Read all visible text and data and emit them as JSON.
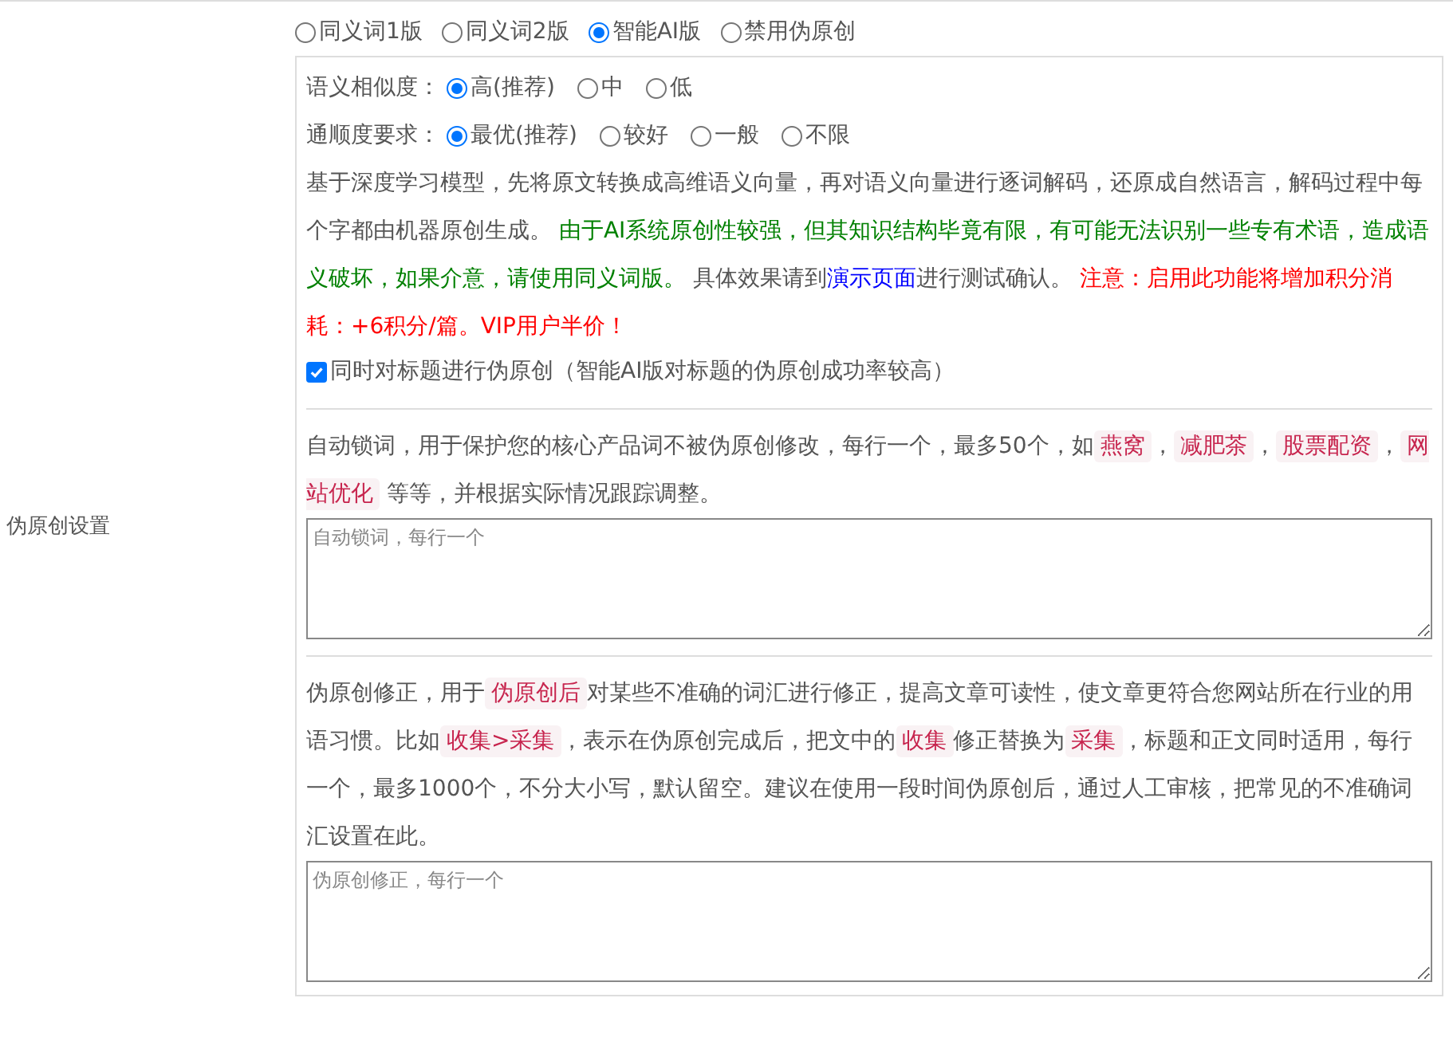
{
  "section_label": "伪原创设置",
  "modes": [
    {
      "label": "同义词1版",
      "selected": false
    },
    {
      "label": "同义词2版",
      "selected": false
    },
    {
      "label": "智能AI版",
      "selected": true
    },
    {
      "label": "禁用伪原创",
      "selected": false
    }
  ],
  "ai_settings": {
    "rows": [
      {
        "label": "语义相似度：",
        "options": [
          {
            "label": "高(推荐)",
            "selected": true
          },
          {
            "label": "中",
            "selected": false
          },
          {
            "label": "低",
            "selected": false
          }
        ]
      },
      {
        "label": "通顺度要求：",
        "options": [
          {
            "label": "最优(推荐)",
            "selected": true
          },
          {
            "label": "较好",
            "selected": false
          },
          {
            "label": "一般",
            "selected": false
          },
          {
            "label": "不限",
            "selected": false
          }
        ]
      }
    ],
    "description": [
      {
        "kind": "text",
        "text": "基于深度学习模型，先将原文转换成高维语义向量，再对语义向量进行逐词解码，还原成自然语言，解码过程中每个字都由机器原创生成。 "
      },
      {
        "kind": "green",
        "text": "由于AI系统原创性较强，但其知识结构毕竟有限，有可能无法识别一些专有术语，造成语义破坏，如果介意，请使用同义词版。"
      },
      {
        "kind": "text",
        "text": " 具体效果请到"
      },
      {
        "kind": "link",
        "text": "演示页面"
      },
      {
        "kind": "text",
        "text": "进行测试确认。 "
      },
      {
        "kind": "red",
        "text": "注意：启用此功能将增加积分消耗：+6积分/篇。VIP用户半价！"
      }
    ],
    "title_rewrite": {
      "label": "同时对标题进行伪原创（智能AI版对标题的伪原创成功率较高）",
      "checked": true
    }
  },
  "lock_words": {
    "description": [
      {
        "kind": "text",
        "text": "自动锁词，用于保护您的核心产品词不被伪原创修改，每行一个，最多50个，如"
      },
      {
        "kind": "tag",
        "text": "燕窝"
      },
      {
        "kind": "text",
        "text": "，"
      },
      {
        "kind": "tag",
        "text": "减肥茶"
      },
      {
        "kind": "text",
        "text": "，"
      },
      {
        "kind": "tag",
        "text": "股票配资"
      },
      {
        "kind": "text",
        "text": "，"
      },
      {
        "kind": "tag",
        "text": "网站优化"
      },
      {
        "kind": "text",
        "text": " 等等，并根据实际情况跟踪调整。"
      }
    ],
    "placeholder": "自动锁词，每行一个"
  },
  "corrections": {
    "description": [
      {
        "kind": "text",
        "text": "伪原创修正，用于"
      },
      {
        "kind": "tag",
        "text": "伪原创后"
      },
      {
        "kind": "text",
        "text": "对某些不准确的词汇进行修正，提高文章可读性，使文章更符合您网站所在行业的用语习惯。比如"
      },
      {
        "kind": "tag",
        "text": "收集>采集"
      },
      {
        "kind": "text",
        "text": "，表示在伪原创完成后，把文中的"
      },
      {
        "kind": "tag",
        "text": "收集"
      },
      {
        "kind": "text",
        "text": "修正替换为"
      },
      {
        "kind": "tag",
        "text": "采集"
      },
      {
        "kind": "text",
        "text": "，标题和正文同时适用，每行一个，最多1000个，不分大小写，默认留空。建议在使用一段时间伪原创后，通过人工审核，把常见的不准确词汇设置在此。"
      }
    ],
    "placeholder": "伪原创修正，每行一个"
  }
}
